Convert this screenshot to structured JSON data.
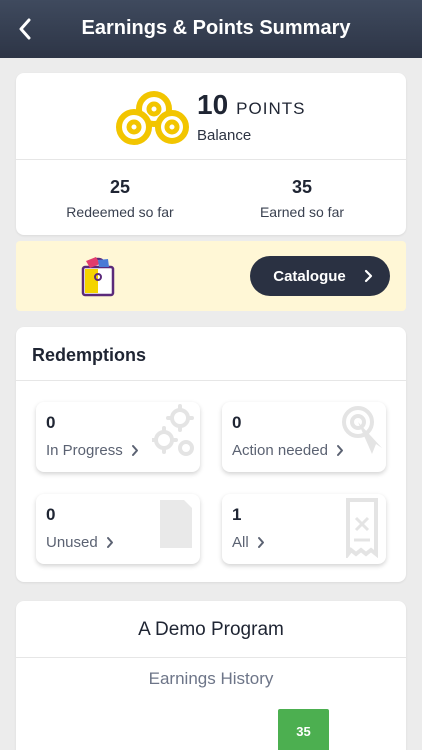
{
  "header": {
    "title": "Earnings & Points Summary",
    "back_icon": "chevron-left-icon"
  },
  "balance": {
    "points": "10",
    "unit": "POINTS",
    "label": "Balance",
    "coin_color": "#f2c500",
    "redeemed_value": "25",
    "redeemed_label": "Redeemed so far",
    "earned_value": "35",
    "earned_label": "Earned so far"
  },
  "catalogue": {
    "button_label": "Catalogue",
    "bag_icon": "shopping-bag-icon",
    "banner_color": "#fff7d6"
  },
  "redemptions": {
    "title": "Redemptions",
    "tiles": [
      {
        "count": "0",
        "label": "In Progress",
        "icon": "gears-icon"
      },
      {
        "count": "0",
        "label": "Action needed",
        "icon": "tap-icon"
      },
      {
        "count": "0",
        "label": "Unused",
        "icon": "card-icon"
      },
      {
        "count": "1",
        "label": "All",
        "icon": "receipt-icon"
      }
    ]
  },
  "program": {
    "title": "A Demo Program",
    "history_title": "Earnings History",
    "bar_value": "35",
    "bar_color": "#4caf50"
  }
}
